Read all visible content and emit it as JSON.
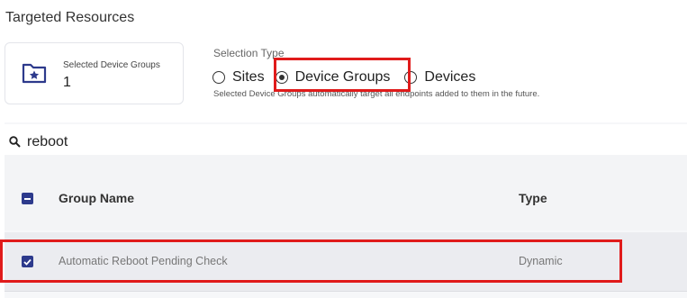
{
  "section": {
    "title": "Targeted Resources"
  },
  "summary": {
    "label": "Selected Device Groups",
    "count": "1",
    "icon": "folder-star-icon"
  },
  "selection": {
    "label": "Selection Type",
    "options": [
      {
        "label": "Sites",
        "selected": false
      },
      {
        "label": "Device Groups",
        "selected": true
      },
      {
        "label": "Devices",
        "selected": false
      }
    ],
    "hint": "Selected Device Groups automatically target all endpoints added to them in the future."
  },
  "search": {
    "value": "reboot",
    "icon": "search-icon"
  },
  "table": {
    "headers": {
      "name": "Group Name",
      "type": "Type"
    },
    "rows": [
      {
        "name": "Automatic Reboot Pending Check",
        "type": "Dynamic",
        "checked": true
      }
    ]
  },
  "colors": {
    "accent": "#2d3a8c",
    "highlight": "#e01b1b",
    "row_selected": "#ebecf0"
  }
}
